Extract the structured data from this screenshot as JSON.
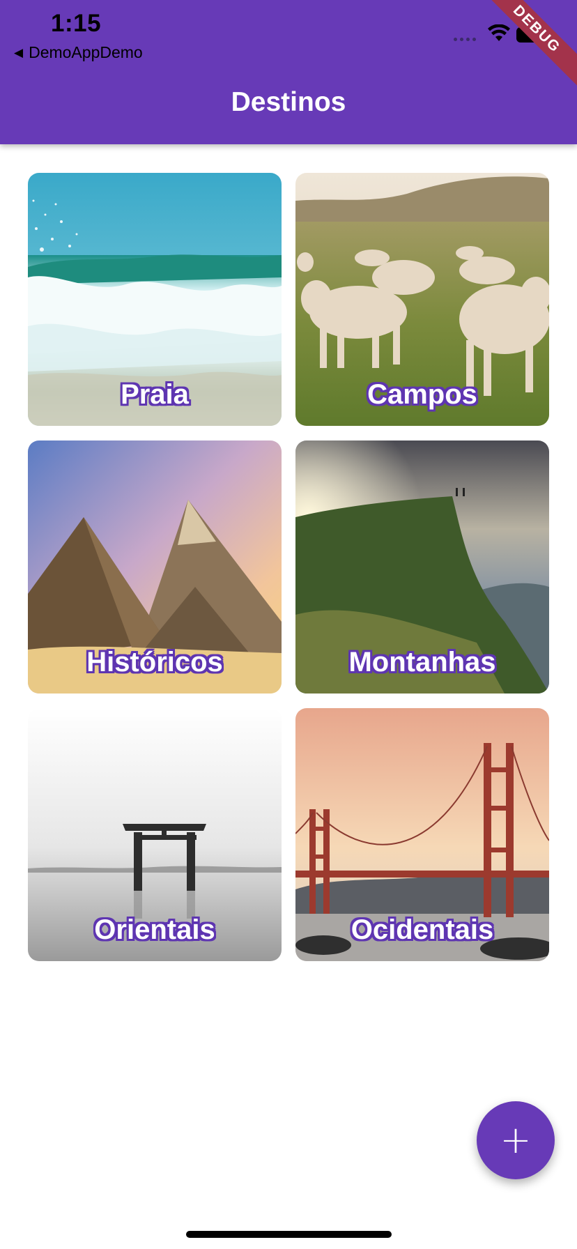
{
  "status_bar": {
    "time": "1:15",
    "back_app_label": "DemoAppDemo",
    "back_icon": "back-triangle-icon",
    "signal_icon": "cellular-signal-icon",
    "wifi_icon": "wifi-icon",
    "battery_icon": "battery-icon"
  },
  "app_bar": {
    "title": "Destinos",
    "debug_banner": "DEBUG"
  },
  "destinations": [
    {
      "label": "Praia",
      "image": "beach-waves"
    },
    {
      "label": "Campos",
      "image": "cows-in-field"
    },
    {
      "label": "Históricos",
      "image": "pyramids"
    },
    {
      "label": "Montanhas",
      "image": "cliff-mountains"
    },
    {
      "label": "Orientais",
      "image": "torii-gate-lake"
    },
    {
      "label": "Ocidentais",
      "image": "golden-gate-bridge"
    }
  ],
  "fab": {
    "icon": "add-icon",
    "symbol": "+"
  },
  "colors": {
    "primary": "#673ab7",
    "label_outline": "#5e35b1",
    "debug_banner": "#a3334b"
  }
}
